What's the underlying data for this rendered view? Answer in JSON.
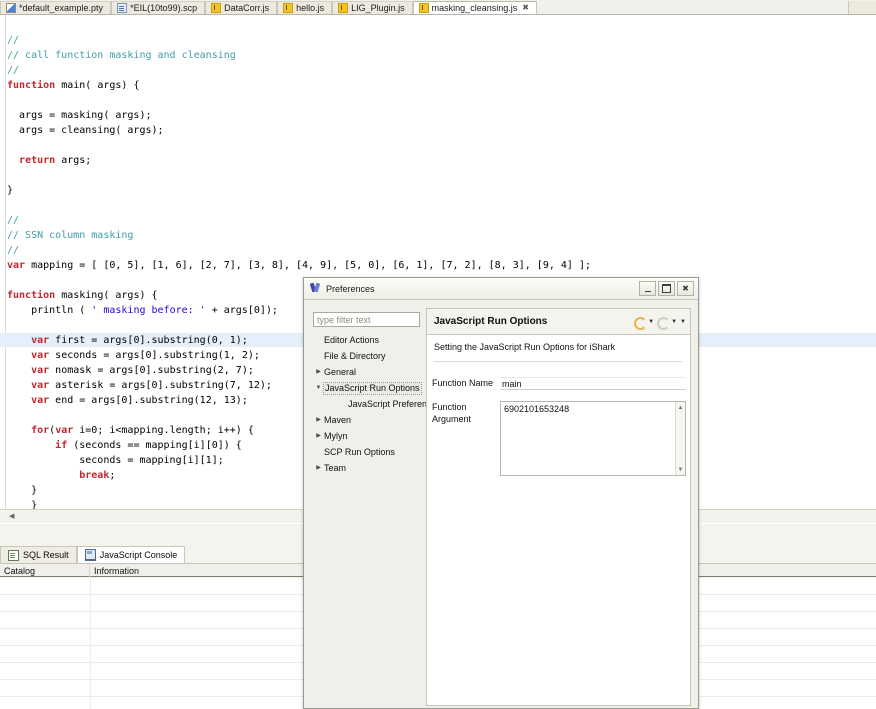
{
  "editor_tabs": [
    {
      "label": "*default_example.pty",
      "icon": "pty-file-icon",
      "active": false,
      "dirty": true
    },
    {
      "label": "*EIL(10to99).scp",
      "icon": "scp-file-icon",
      "active": false,
      "dirty": true
    },
    {
      "label": "DataCorr.js",
      "icon": "js-file-icon",
      "active": false,
      "dirty": false
    },
    {
      "label": "hello.js",
      "icon": "js-file-icon",
      "active": false,
      "dirty": false
    },
    {
      "label": "LIG_Plugin.js",
      "icon": "js-file-icon",
      "active": false,
      "dirty": false
    },
    {
      "label": "masking_cleansing.js",
      "icon": "js-file-icon",
      "active": true,
      "dirty": false,
      "close": "✖"
    }
  ],
  "code_lines": [
    [
      {
        "t": "//",
        "c": "cm"
      }
    ],
    [
      {
        "t": "// call function masking and cleansing",
        "c": "cm"
      }
    ],
    [
      {
        "t": "//",
        "c": "cm"
      }
    ],
    [
      {
        "t": "function",
        "c": "kw"
      },
      {
        "t": " main( args) {",
        "c": ""
      }
    ],
    [
      {
        "t": "",
        "c": ""
      }
    ],
    [
      {
        "t": "  args = masking( args);",
        "c": ""
      }
    ],
    [
      {
        "t": "  args = cleansing( args);",
        "c": ""
      }
    ],
    [
      {
        "t": "",
        "c": ""
      }
    ],
    [
      {
        "t": "  ",
        "c": ""
      },
      {
        "t": "return",
        "c": "kw"
      },
      {
        "t": " args;",
        "c": ""
      }
    ],
    [
      {
        "t": "",
        "c": ""
      }
    ],
    [
      {
        "t": "}",
        "c": ""
      }
    ],
    [
      {
        "t": "",
        "c": ""
      }
    ],
    [
      {
        "t": "//",
        "c": "cm"
      }
    ],
    [
      {
        "t": "// SSN column masking",
        "c": "cm"
      }
    ],
    [
      {
        "t": "//",
        "c": "cm"
      }
    ],
    [
      {
        "t": "var",
        "c": "kw"
      },
      {
        "t": " mapping = [ [0, 5], [1, 6], [2, 7], [3, 8], [4, 9], [5, 0], [6, 1], [7, 2], [8, 3], [9, 4] ];",
        "c": ""
      }
    ],
    [
      {
        "t": "",
        "c": ""
      }
    ],
    [
      {
        "t": "function",
        "c": "kw"
      },
      {
        "t": " masking( args) {",
        "c": ""
      }
    ],
    [
      {
        "t": "    println ( ",
        "c": ""
      },
      {
        "t": "' masking before: '",
        "c": "str"
      },
      {
        "t": " + args[0]);",
        "c": ""
      }
    ],
    [
      {
        "t": "",
        "c": ""
      }
    ],
    [
      {
        "t": "    ",
        "c": ""
      },
      {
        "t": "var",
        "c": "kw"
      },
      {
        "t": " first = args[0].substring(0, 1);",
        "c": ""
      }
    ],
    [
      {
        "t": "    ",
        "c": ""
      },
      {
        "t": "var",
        "c": "kw"
      },
      {
        "t": " seconds = args[0].substring(1, 2);",
        "c": ""
      }
    ],
    [
      {
        "t": "    ",
        "c": ""
      },
      {
        "t": "var",
        "c": "kw"
      },
      {
        "t": " nomask = args[0].substring(2, 7);",
        "c": ""
      }
    ],
    [
      {
        "t": "    ",
        "c": ""
      },
      {
        "t": "var",
        "c": "kw"
      },
      {
        "t": " asterisk = args[0].substring(7, 12);",
        "c": ""
      }
    ],
    [
      {
        "t": "    ",
        "c": ""
      },
      {
        "t": "var",
        "c": "kw"
      },
      {
        "t": " end = args[0].substring(12, 13);",
        "c": ""
      }
    ],
    [
      {
        "t": "",
        "c": ""
      }
    ],
    [
      {
        "t": "    ",
        "c": ""
      },
      {
        "t": "for",
        "c": "kw"
      },
      {
        "t": "(",
        "c": ""
      },
      {
        "t": "var",
        "c": "kw"
      },
      {
        "t": " i=0; i<mapping.length; i++) {",
        "c": ""
      }
    ],
    [
      {
        "t": "        ",
        "c": ""
      },
      {
        "t": "if",
        "c": "kw"
      },
      {
        "t": " (seconds == mapping[i][0]) {",
        "c": ""
      }
    ],
    [
      {
        "t": "            seconds = mapping[i][1];",
        "c": ""
      }
    ],
    [
      {
        "t": "            ",
        "c": ""
      },
      {
        "t": "break",
        "c": "kw"
      },
      {
        "t": ";",
        "c": ""
      }
    ],
    [
      {
        "t": "    }",
        "c": ""
      }
    ],
    [
      {
        "t": "    }",
        "c": ""
      }
    ]
  ],
  "bottom_panel": {
    "tabs": [
      {
        "label": "SQL Result",
        "icon": "sql-result-icon",
        "active": false
      },
      {
        "label": "JavaScript Console",
        "icon": "console-icon",
        "active": true
      }
    ],
    "columns": [
      "Catalog",
      "Information"
    ],
    "rows": []
  },
  "dialog": {
    "title": "Preferences",
    "window_buttons": {
      "minimize": "minimize",
      "maximize": "restore",
      "close": "✖"
    },
    "filter_placeholder": "type filter text",
    "filter_value": "",
    "tree": [
      {
        "label": "Editor Actions",
        "level": 1,
        "expandable": false,
        "selected": false
      },
      {
        "label": "File & Directory",
        "level": 1,
        "expandable": false,
        "selected": false
      },
      {
        "label": "General",
        "level": 1,
        "expandable": true,
        "expanded": false,
        "selected": false
      },
      {
        "label": "JavaScript Run Options",
        "level": 1,
        "expandable": true,
        "expanded": true,
        "selected": true
      },
      {
        "label": "JavaScript Preference",
        "level": 2,
        "expandable": false,
        "selected": false
      },
      {
        "label": "Maven",
        "level": 1,
        "expandable": true,
        "expanded": false,
        "selected": false
      },
      {
        "label": "Mylyn",
        "level": 1,
        "expandable": true,
        "expanded": false,
        "selected": false
      },
      {
        "label": "SCP Run Options",
        "level": 1,
        "expandable": false,
        "selected": false
      },
      {
        "label": "Team",
        "level": 1,
        "expandable": true,
        "expanded": false,
        "selected": false
      }
    ],
    "panel": {
      "heading": "JavaScript Run Options",
      "description": "Setting the JavaScript Run Options for iShark",
      "fields": {
        "function_name_label": "Function Name",
        "function_name_value": "main",
        "function_argument_label": "Function Argument",
        "function_argument_value": "6902101653248"
      }
    }
  },
  "colors": {
    "keyword": "#c0272d",
    "comment": "#3f9ea5",
    "string": "#2a00dd",
    "selected_line": "#e5eefb",
    "chrome": "#f0efe9",
    "nav_accent": "#e3b84a"
  }
}
